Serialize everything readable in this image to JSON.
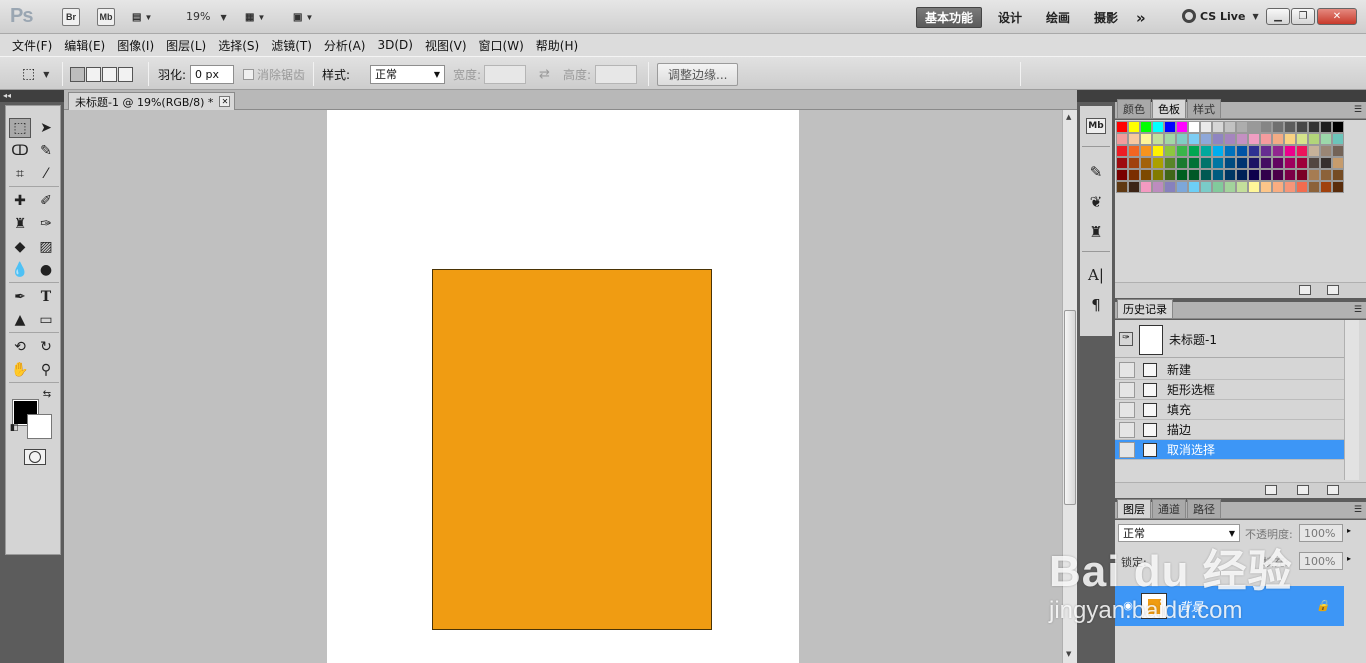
{
  "app": {
    "logo": "Ps",
    "bridge_label": "Br",
    "minibridge_label": "Mb",
    "zoom": "19%",
    "workspaces": [
      "基本功能",
      "设计",
      "绘画",
      "摄影"
    ],
    "more": "»",
    "cslive": "CS Live"
  },
  "menu": [
    "文件(F)",
    "编辑(E)",
    "图像(I)",
    "图层(L)",
    "选择(S)",
    "滤镜(T)",
    "分析(A)",
    "3D(D)",
    "视图(V)",
    "窗口(W)",
    "帮助(H)"
  ],
  "options": {
    "feather_label": "羽化:",
    "feather_value": "0 px",
    "antialias_label": "消除锯齿",
    "style_label": "样式:",
    "style_value": "正常",
    "width_label": "宽度:",
    "height_label": "高度:",
    "refine_label": "调整边缘..."
  },
  "document": {
    "tab_title": "未标题-1 @ 19%(RGB/8) *",
    "canvas_color": "#ffffff",
    "shape_color": "#f09c12"
  },
  "panels": {
    "swatches_tabs": [
      "颜色",
      "色板",
      "样式"
    ],
    "swatch_colors": [
      "#ff0000",
      "#ffff00",
      "#00ff00",
      "#00ffff",
      "#0000ff",
      "#ff00ff",
      "#ffffff",
      "#ebebeb",
      "#d6d6d6",
      "#c2c2c2",
      "#adadad",
      "#999999",
      "#858585",
      "#707070",
      "#5c5c5c",
      "#474747",
      "#333333",
      "#1f1f1f",
      "#000000",
      "#f29c9c",
      "#f7c9a0",
      "#fdf59a",
      "#c3df9c",
      "#a3d7a6",
      "#80cdc4",
      "#7dcdf4",
      "#8ea8d9",
      "#8f85c1",
      "#a585be",
      "#c490c2",
      "#f09ec2",
      "#f49c9e",
      "#f3ac85",
      "#f9d283",
      "#d5e38b",
      "#b2d57a",
      "#9cd8aa",
      "#6cc5ba",
      "#ed1c24",
      "#f26522",
      "#f7941d",
      "#fff200",
      "#8dc63f",
      "#39b54a",
      "#00a651",
      "#00a99d",
      "#00aeef",
      "#0072bc",
      "#0054a6",
      "#2e3192",
      "#662d91",
      "#92278f",
      "#ec008c",
      "#ed145b",
      "#c7b299",
      "#998675",
      "#736357",
      "#9e0b0f",
      "#a0410d",
      "#a36209",
      "#aba000",
      "#598527",
      "#1a7b30",
      "#007236",
      "#00746b",
      "#0076a3",
      "#004b80",
      "#003471",
      "#1b1464",
      "#440e62",
      "#630460",
      "#9e005d",
      "#9e0039",
      "#534741",
      "#362f2d",
      "#c69c6d",
      "#790000",
      "#7b2e00",
      "#7d4900",
      "#827b00",
      "#406618",
      "#005e20",
      "#005826",
      "#005952",
      "#005b7f",
      "#003663",
      "#002157",
      "#0d004c",
      "#32004b",
      "#4b0049",
      "#7b0046",
      "#7a0026",
      "#a67c52",
      "#8c6239",
      "#754c24",
      "#603913",
      "#3c2415",
      "#f49ac1",
      "#bd8cbf",
      "#8781bd",
      "#7da7d9",
      "#6dcff6",
      "#7accc8",
      "#82ca9c",
      "#a3d39c",
      "#c4df9b",
      "#fff799",
      "#fdc689",
      "#f9ad81",
      "#f69679",
      "#f26c4f",
      "#8c6239",
      "#a0410d",
      "#5a2d0c"
    ],
    "history_tab": "历史记录",
    "history_snapshot": "未标题-1",
    "history_items": [
      "新建",
      "矩形选框",
      "填充",
      "描边",
      "取消选择"
    ],
    "history_selected": 4,
    "layers_tabs": [
      "图层",
      "通道",
      "路径"
    ],
    "blend_mode": "正常",
    "opacity_label": "不透明度:",
    "opacity_value": "100%",
    "lock_label": "锁定:",
    "fill_label": "填充:",
    "fill_value": "100%",
    "layer_name": "背景"
  },
  "watermark": {
    "brand": "Bai du 经验",
    "url": "jingyan.baidu.com"
  }
}
